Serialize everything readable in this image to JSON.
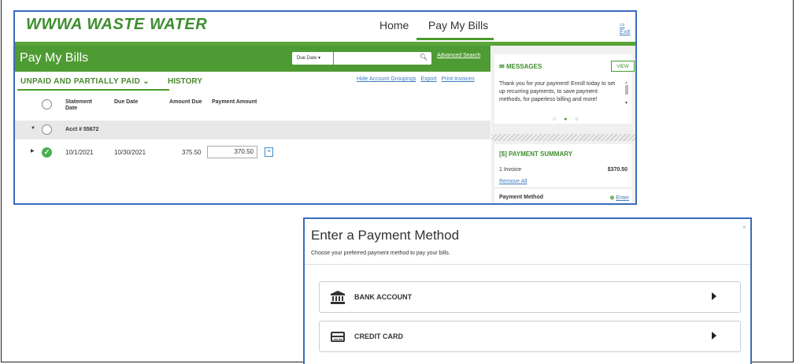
{
  "app": {
    "logo": "WWWA WASTE WATER",
    "nav": {
      "home": "Home",
      "pay_bills": "Pay My Bills",
      "exit": "Exit"
    }
  },
  "page": {
    "title": "Pay My Bills",
    "sort_select": "Due Date",
    "search_placeholder": "",
    "advanced_search": "Advanced Search",
    "tabs": {
      "unpaid": "UNPAID AND PARTIALLY PAID",
      "history": "HISTORY"
    },
    "links": [
      "Hide Account Groupings",
      "Export",
      "Print Invoices"
    ]
  },
  "table": {
    "headers": {
      "statement_date": "Statement Date",
      "due_date": "Due Date",
      "amount_due": "Amount Due",
      "payment_amount": "Payment Amount"
    },
    "account_label": "Acct # 55672",
    "rows": [
      {
        "statement_date": "10/1/2021",
        "due_date": "10/30/2021",
        "amount_due": "375.50",
        "payment_amount": "370.50"
      }
    ]
  },
  "messages": {
    "title": "MESSAGES",
    "view_label": "VIEW",
    "text": "Thank you for your payment! Enroll today to set up recurring payments, to save payment methods, for paperless billing and more!",
    "dots": "○ ● ○"
  },
  "payment_summary": {
    "title": "PAYMENT SUMMARY",
    "invoice_count": "1 Invoice",
    "total": "$370.50",
    "remove_all": "Remove All",
    "method_label": "Payment Method",
    "enter_label": "Enter"
  },
  "modal": {
    "title": "Enter a Payment Method",
    "subtitle": "Choose your preferred payment method to pay your bills.",
    "close": "×",
    "options": [
      {
        "label": "BANK ACCOUNT",
        "icon": "bank-icon"
      },
      {
        "label": "CREDIT CARD",
        "icon": "credit-card-icon"
      }
    ]
  },
  "colors": {
    "brand_green": "#4e9b33",
    "link_blue": "#3b7bbf",
    "highlight_border": "#3b6bc0"
  }
}
